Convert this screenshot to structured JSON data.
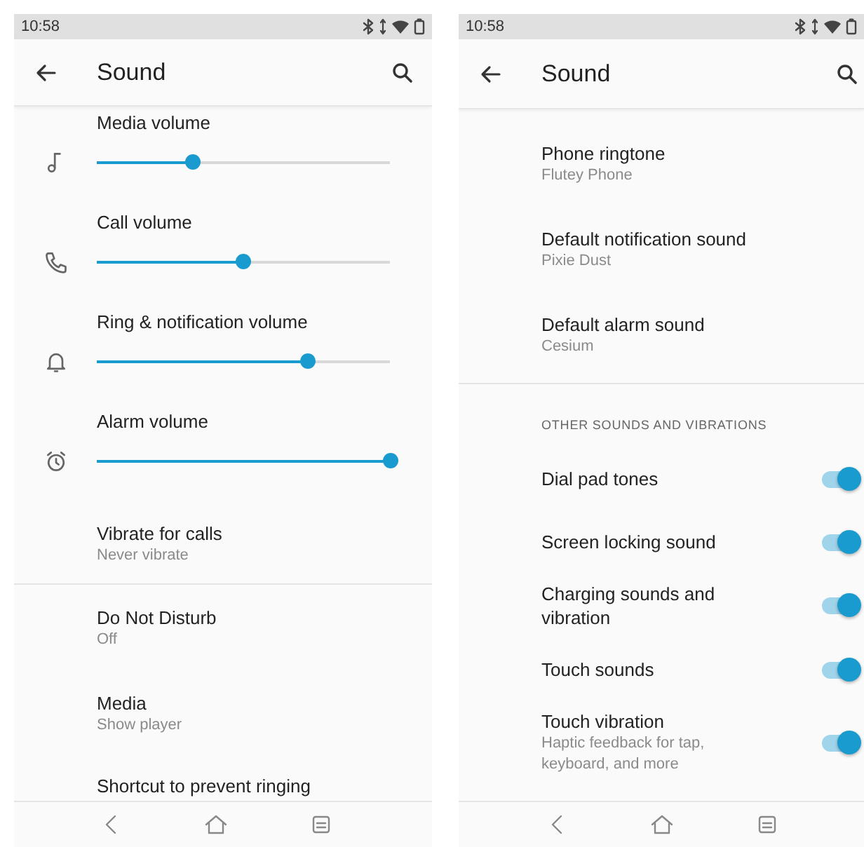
{
  "screens": [
    {
      "status_bar": {
        "time": "10:58"
      },
      "title": "Sound",
      "items": [
        {
          "kind": "slider",
          "label": "Media volume",
          "level": 0.33
        },
        {
          "kind": "slider",
          "label": "Call volume",
          "level": 0.5
        },
        {
          "kind": "slider",
          "label": "Ring & notification volume",
          "level": 0.72
        },
        {
          "kind": "slider",
          "label": "Alarm volume",
          "level": 1.0
        },
        {
          "kind": "setting",
          "label": "Vibrate for calls",
          "summary": "Never vibrate"
        },
        {
          "kind": "divider"
        },
        {
          "kind": "setting",
          "label": "Do Not Disturb",
          "summary": "Off"
        },
        {
          "kind": "setting",
          "label": "Media",
          "summary": "Show player"
        },
        {
          "kind": "setting",
          "label": "Shortcut to prevent ringing"
        }
      ]
    },
    {
      "status_bar": {
        "time": "10:58"
      },
      "title": "Sound",
      "items": [
        {
          "kind": "setting",
          "label": "Phone ringtone",
          "summary": "Flutey Phone"
        },
        {
          "kind": "setting",
          "label": "Default notification sound",
          "summary": "Pixie Dust"
        },
        {
          "kind": "setting",
          "label": "Default alarm sound",
          "summary": "Cesium"
        },
        {
          "kind": "divider"
        },
        {
          "kind": "header",
          "label": "OTHER SOUNDS AND VIBRATIONS"
        },
        {
          "kind": "toggle",
          "label": "Dial pad tones",
          "on": true
        },
        {
          "kind": "toggle",
          "label": "Screen locking sound",
          "on": true
        },
        {
          "kind": "toggle",
          "label": "Charging sounds and vibration",
          "on": true
        },
        {
          "kind": "toggle",
          "label": "Touch sounds",
          "on": true
        },
        {
          "kind": "toggle",
          "label": "Touch vibration",
          "summary": "Haptic feedback for tap, keyboard, and more",
          "on": true
        }
      ]
    }
  ]
}
